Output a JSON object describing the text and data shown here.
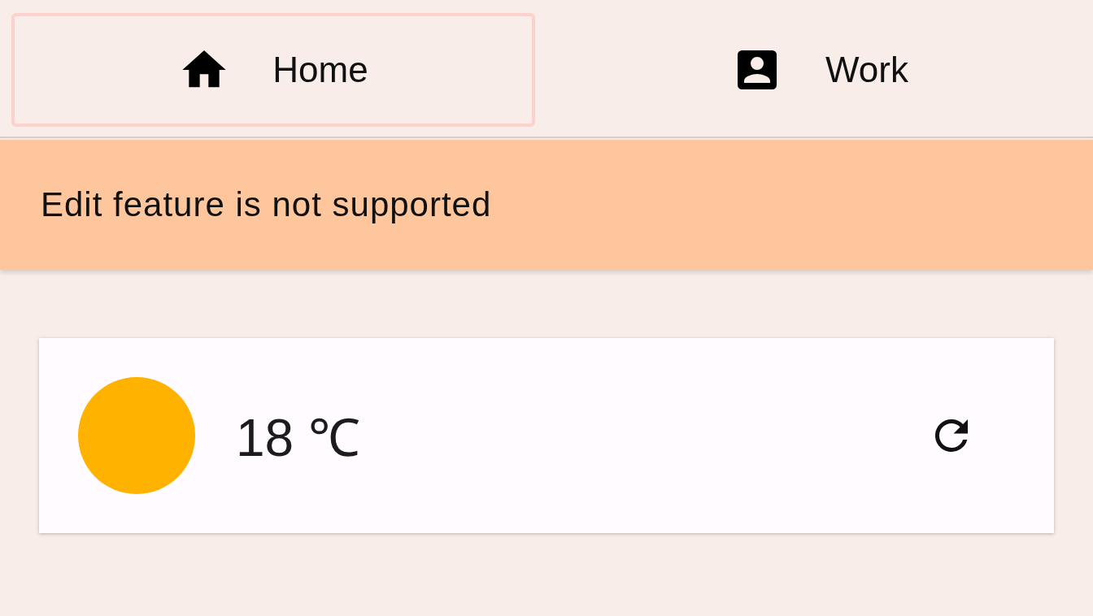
{
  "tabs": [
    {
      "label": "Home",
      "kind": "home",
      "selected": true
    },
    {
      "label": "Work",
      "kind": "person",
      "selected": false
    }
  ],
  "snackbar": {
    "message": "Edit feature is not supported"
  },
  "weather_card": {
    "temperature": "18 ℃"
  }
}
